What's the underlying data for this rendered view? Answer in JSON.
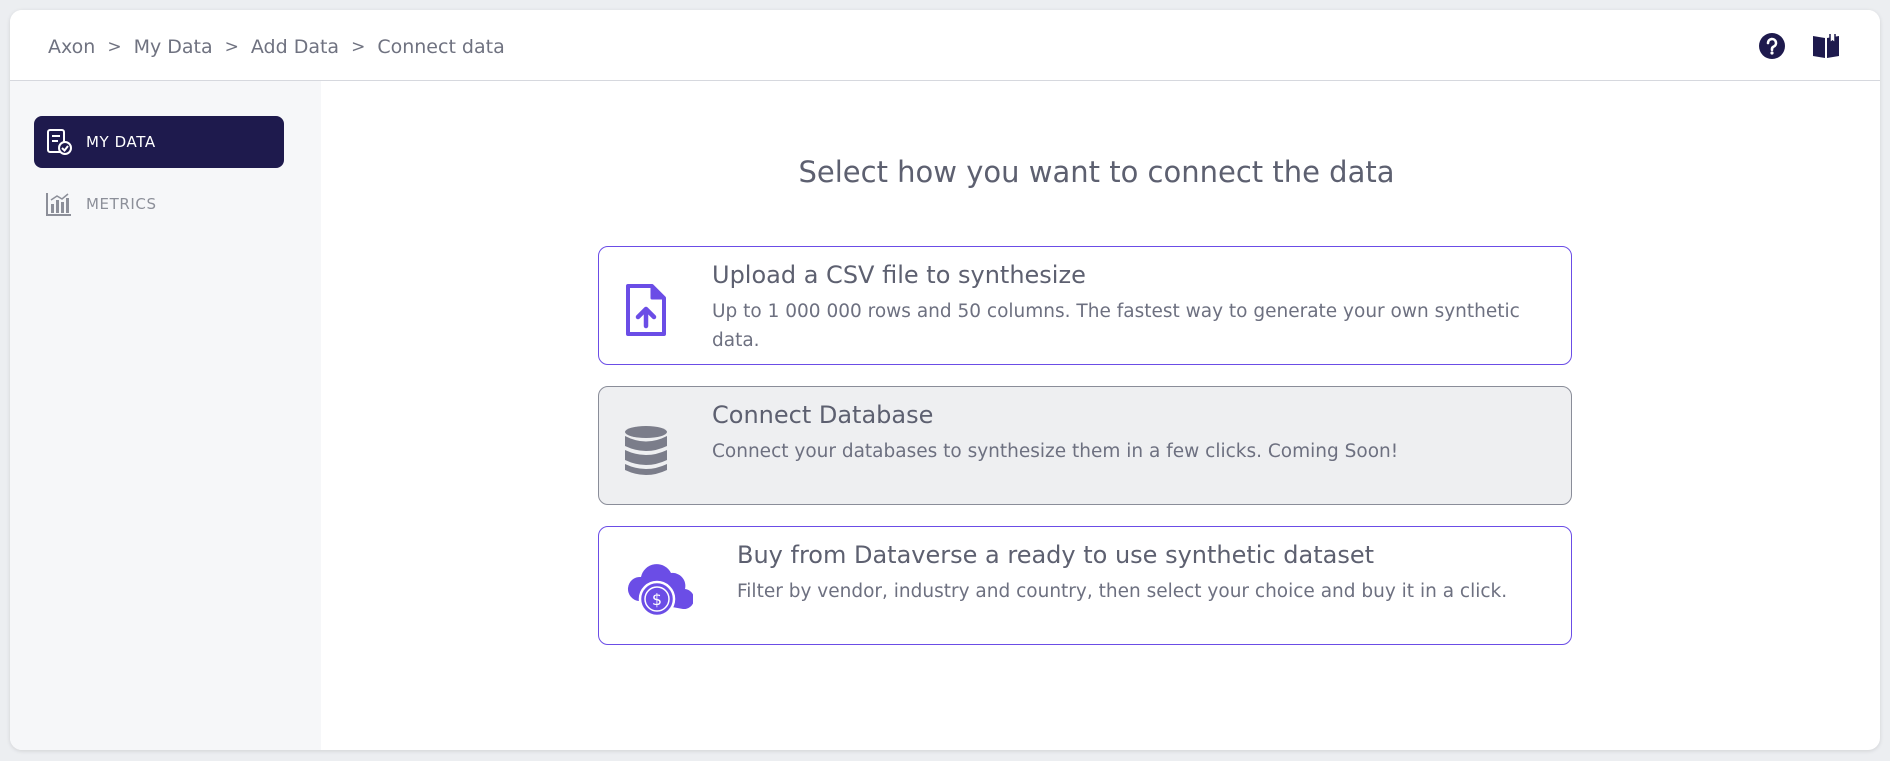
{
  "breadcrumb": {
    "items": [
      "Axon",
      "My Data",
      "Add Data",
      "Connect data"
    ],
    "separator": ">"
  },
  "sidebar": {
    "items": [
      {
        "label": "MY DATA",
        "icon": "document-check-icon",
        "active": true
      },
      {
        "label": "METRICS",
        "icon": "bar-chart-icon",
        "active": false
      }
    ]
  },
  "main": {
    "heading": "Select how you want to connect the data",
    "options": [
      {
        "title": "Upload a CSV file to synthesize",
        "description": "Up to 1 000 000 rows and 50 columns. The fastest way to generate your own synthetic data.",
        "icon": "file-upload-icon"
      },
      {
        "title": "Connect Database",
        "description": "Connect your databases to synthesize them in a few clicks. Coming Soon!",
        "icon": "database-icon"
      },
      {
        "title": "Buy from Dataverse a ready to use synthetic dataset",
        "description": "Filter by vendor, industry and country, then select your choice and buy it in a click.",
        "icon": "cloud-dollar-icon"
      }
    ]
  },
  "topbar": {
    "icons": [
      "help-icon",
      "book-icon"
    ]
  },
  "colors": {
    "accent": "#6b4de6",
    "nav_active_bg": "#1e1a4d",
    "text_muted": "#6d7080",
    "disabled_bg": "#eeeff1"
  }
}
